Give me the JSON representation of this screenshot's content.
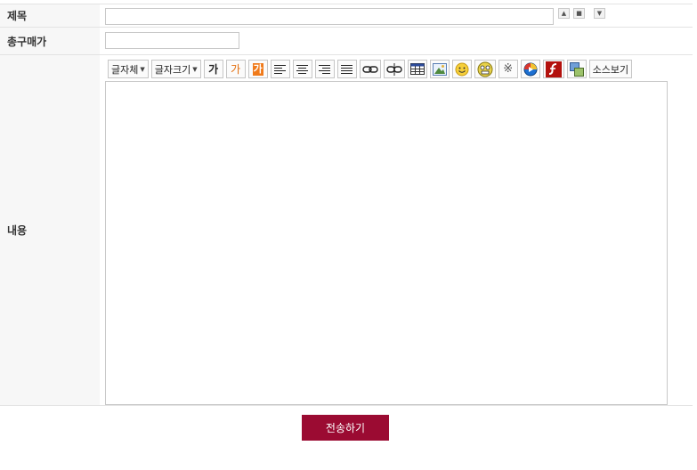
{
  "form": {
    "title_label": "제목",
    "price_label": "총구매가",
    "content_label": "내용",
    "title_value": "",
    "price_value": ""
  },
  "size_buttons": [
    "▲",
    "■",
    "▼"
  ],
  "toolbar": {
    "font_label": "글자체",
    "fontsize_label": "글자크기",
    "bold_glyph": "가",
    "color_glyph": "가",
    "bgcolor_glyph": "가",
    "special_char_glyph": "※",
    "source_label": "소스보기"
  },
  "submit_label": "전송하기",
  "colors": {
    "accent": "#9b0b32",
    "orange": "#e36c0a"
  }
}
